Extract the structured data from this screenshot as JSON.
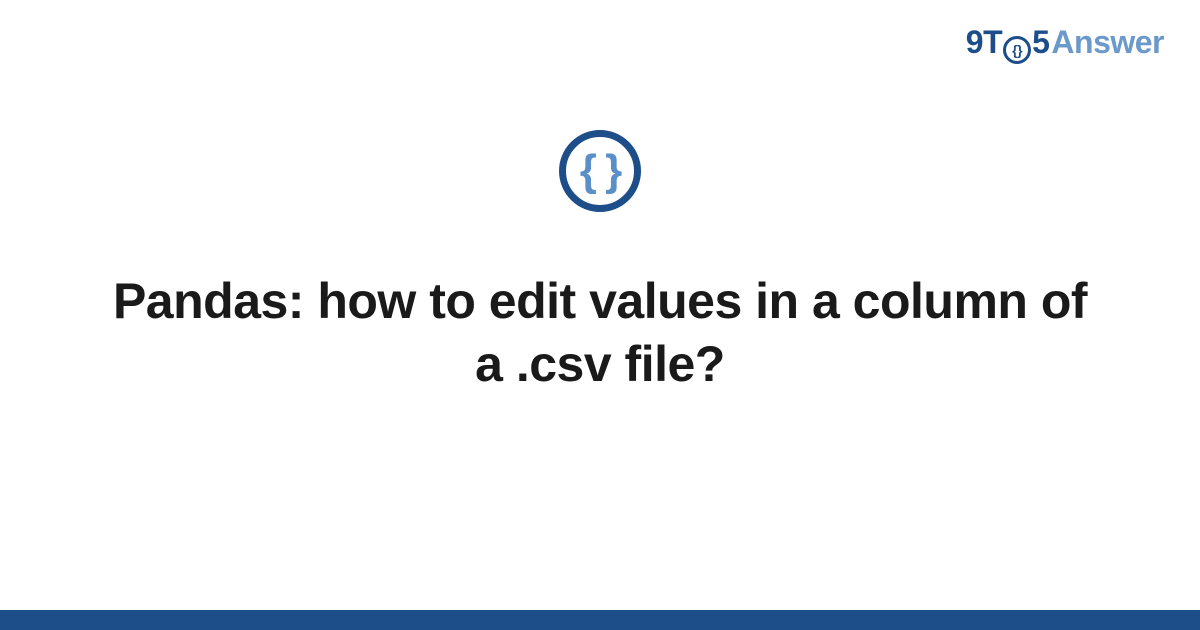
{
  "logo": {
    "part1": "9T",
    "part_o_inner": "{}",
    "part2": "5",
    "part3": "Answer"
  },
  "badge": {
    "symbol": "{ }"
  },
  "title": "Pandas: how to edit values in a column of a .csv file?",
  "colors": {
    "primary": "#1d4e89",
    "secondary": "#6b99c9",
    "brace": "#5a8fc7"
  }
}
